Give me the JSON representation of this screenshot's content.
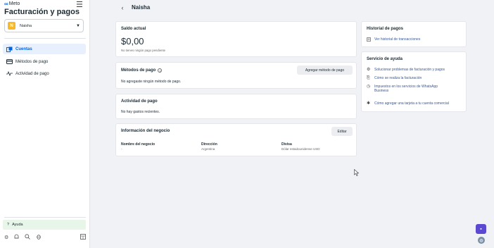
{
  "brand": {
    "name": "Meto"
  },
  "app": {
    "title": "Facturación y pagos"
  },
  "account": {
    "initial": "N",
    "name": "Naisha"
  },
  "nav": {
    "items": [
      {
        "label": "Cuentas",
        "icon": "accounts-icon"
      },
      {
        "label": "Métodos de pago",
        "icon": "card-icon"
      },
      {
        "label": "Actividad de pago",
        "icon": "activity-icon"
      }
    ],
    "help_label": "Ayuda"
  },
  "page": {
    "title": "Naisha"
  },
  "balance": {
    "title": "Saldo actual",
    "amount": "$0,00",
    "note": "No tienes ningún pago pendiente"
  },
  "payment_methods": {
    "title": "Métodos de pago",
    "add_button": "Agregar método de pago",
    "empty": "No agregaste ningún método de pago."
  },
  "activity": {
    "title": "Actividad de pago",
    "empty": "No hay gastos recientes."
  },
  "business": {
    "title": "Información del negocio",
    "edit_button": "Editar",
    "columns": [
      {
        "label": "Nombre del negocio",
        "value": "-"
      },
      {
        "label": "Dirección",
        "value": "Argentina"
      },
      {
        "label": "Divisa",
        "value": "Dólar estadounidense USD"
      }
    ]
  },
  "history": {
    "title": "Historial de pagos",
    "link": "Ver historial de transacciones"
  },
  "help_center": {
    "title": "Servicio de ayuda",
    "links": [
      "Solucionar problemas de facturación y pagos",
      "Cómo se realiza la facturación",
      "Impuestos en los servicios de WhatsApp Business",
      "Cómo agregar una tarjeta a tu cuenta comercial"
    ]
  },
  "colors": {
    "accent": "#0064e0",
    "chat": "#5b4ad1",
    "help_bg": "#e8f5e9"
  }
}
